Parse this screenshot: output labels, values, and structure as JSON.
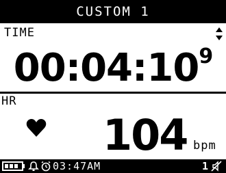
{
  "header": {
    "title": "CUSTOM 1"
  },
  "top_field": {
    "label": "TIME",
    "value_main": "00:04:10",
    "value_fraction": "9",
    "scroll_icon": "up-down-arrows-icon"
  },
  "bottom_field": {
    "label": "HR",
    "value": "104",
    "unit": "bpm",
    "icon": "heart-icon"
  },
  "status": {
    "battery_icon": "battery-icon",
    "bell_icon": "bell-icon",
    "alarm_icon": "alarm-clock-icon",
    "time": "03:47AM",
    "page": "1",
    "mute_icon": "mute-icon"
  }
}
